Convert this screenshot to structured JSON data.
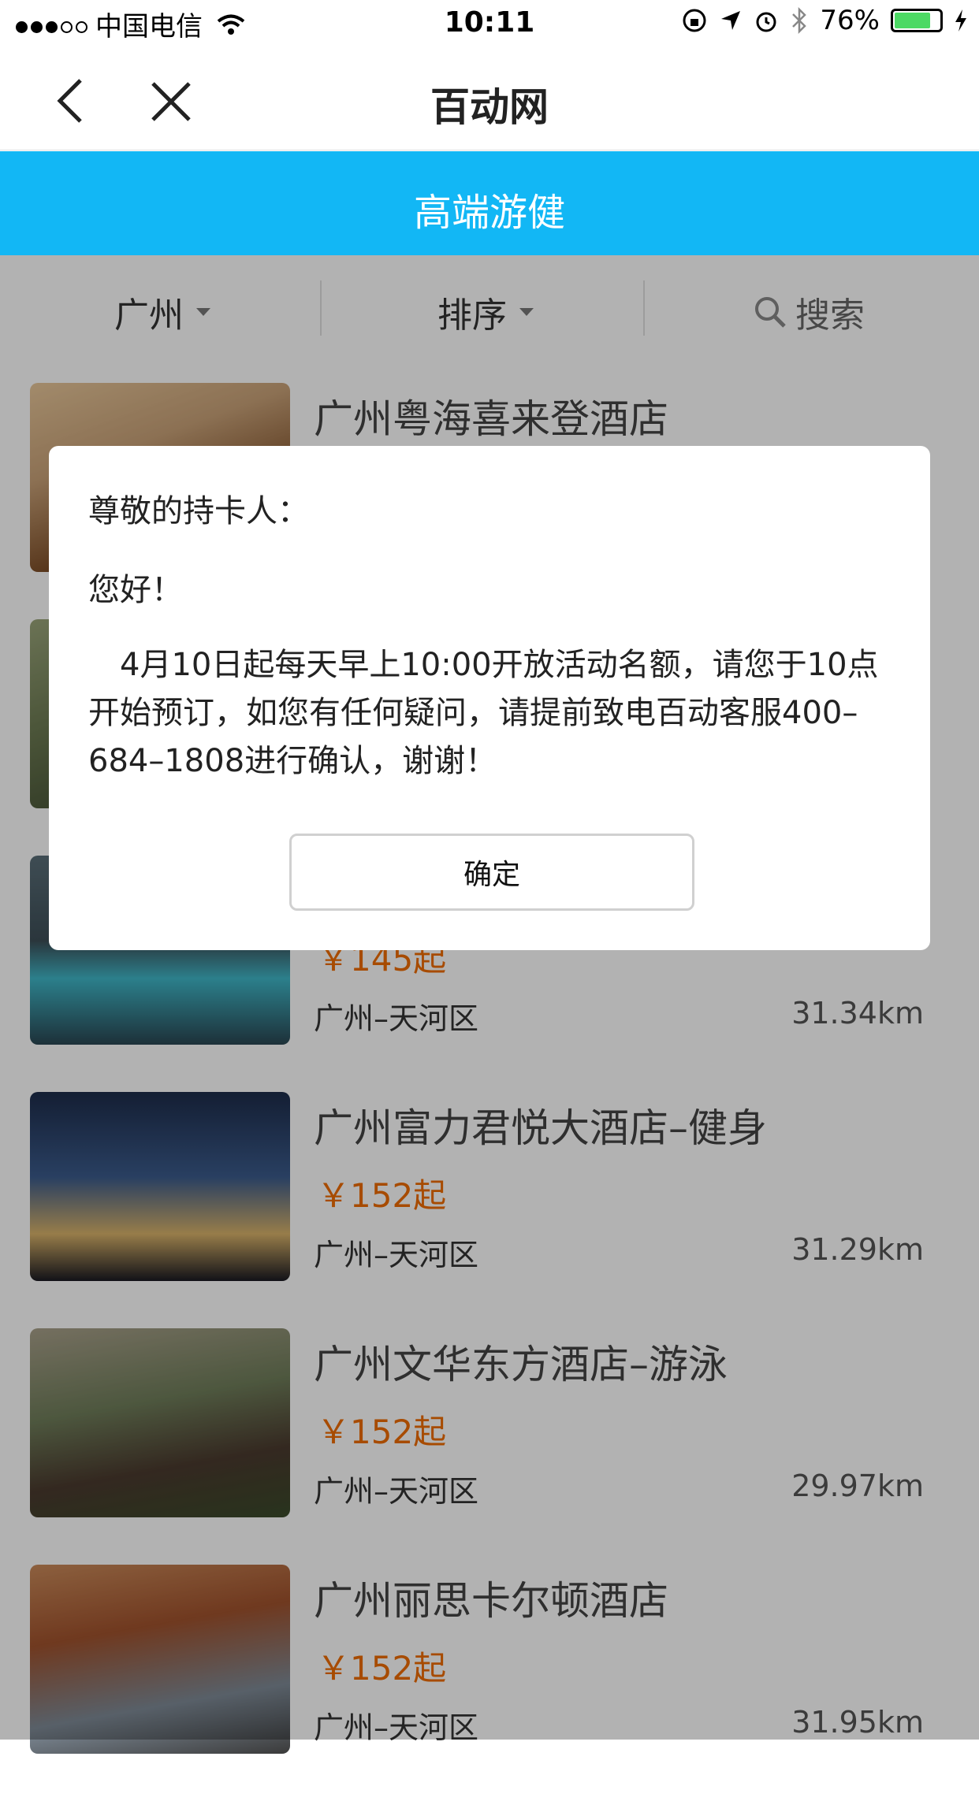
{
  "status_bar": {
    "carrier": "中国电信",
    "time": "10:11",
    "battery": "76%",
    "battery_level": 0.76
  },
  "nav": {
    "title": "百动网"
  },
  "banner": {
    "title": "高端游健"
  },
  "filter": {
    "city": "广州",
    "sort": "排序",
    "search": "搜索"
  },
  "list": [
    {
      "name": "广州粤海喜来登酒店",
      "price": "",
      "area": "",
      "distance": "",
      "colors": [
        "#c9a278",
        "#7a4a24",
        "#e8c79a"
      ]
    },
    {
      "name": "",
      "price": "",
      "area": "",
      "distance": "",
      "colors": [
        "#6c7a52",
        "#2f3a24",
        "#9aa57a"
      ]
    },
    {
      "name": "",
      "price": "￥145起",
      "area": "广州–天河区",
      "distance": "31.34km",
      "colors": [
        "#5a6e78",
        "#3fb7c8",
        "#2a4652"
      ]
    },
    {
      "name": "广州富力君悦大酒店–健身",
      "price": "￥152起",
      "area": "广州–天河区",
      "distance": "31.29km",
      "colors": [
        "#1d2c4a",
        "#3b5b8c",
        "#d9b36a"
      ]
    },
    {
      "name": "广州文华东方酒店–游泳",
      "price": "￥152起",
      "area": "广州–天河区",
      "distance": "29.97km",
      "colors": [
        "#6f7d5a",
        "#4a3a2e",
        "#a8a08a"
      ]
    },
    {
      "name": "广州丽思卡尔顿酒店",
      "price": "￥152起",
      "area": "广州–天河区",
      "distance": "31.95km",
      "colors": [
        "#a0522d",
        "#7e8a96",
        "#c98a5a"
      ]
    }
  ],
  "dialog": {
    "greeting": "尊敬的持卡人：",
    "hello": "您好！",
    "message": "4月10日起每天早上10:00开放活动名额，请您于10点开始预订，如您有任何疑问，请提前致电百动客服400–684–1808进行确认，谢谢！",
    "confirm": "确定"
  }
}
